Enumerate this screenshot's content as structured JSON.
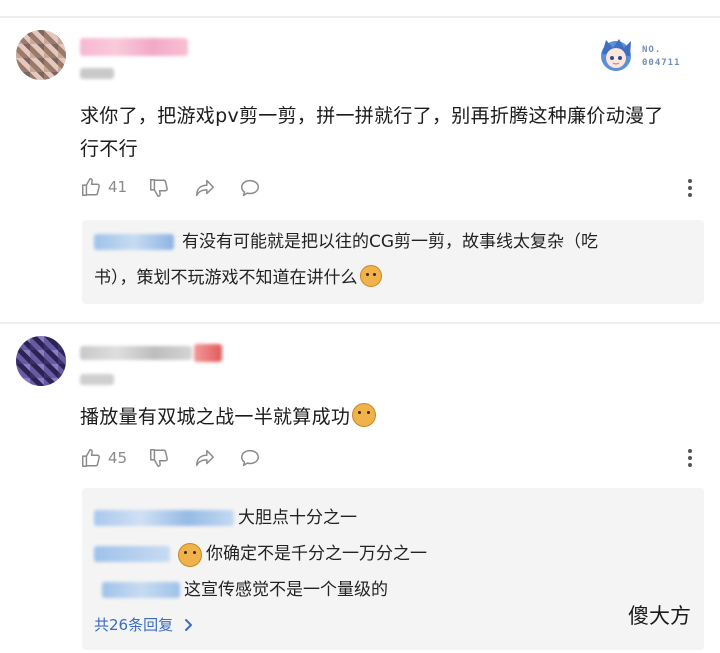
{
  "comments": [
    {
      "text_line1": "求你了，把游戏pv剪一剪，拼一拼就行了，别再折腾这种廉价动漫了",
      "text_line2": "行不行",
      "likes": "41",
      "badge_line1": "NO.",
      "badge_line2": "004711",
      "reply": {
        "line1": "有没有可能就是把以往的CG剪一剪，故事线太复杂（吃",
        "line2": "书），策划不玩游戏不知道在讲什么"
      }
    },
    {
      "text": "播放量有双城之战一半就算成功",
      "likes": "45",
      "replies": [
        {
          "text": "大胆点十分之一"
        },
        {
          "text": "你确定不是千分之一万分之一"
        },
        {
          "text": "这宣传感觉不是一个量级的"
        }
      ],
      "more_replies_label": "共26条回复"
    }
  ],
  "watermark": "傻大方",
  "colors": {
    "link": "#3b6cc4",
    "action_gray": "#8a8a8a",
    "reply_bg": "#f4f4f4"
  }
}
